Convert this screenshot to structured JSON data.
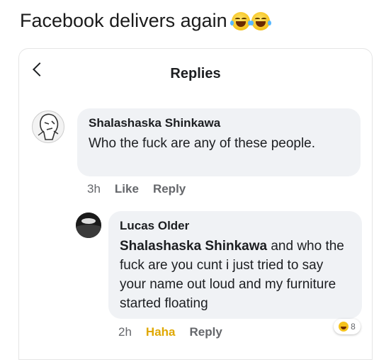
{
  "caption": {
    "text": "Facebook delivers again"
  },
  "header": {
    "title": "Replies"
  },
  "comments": [
    {
      "author": "Shalashaska Shinkawa",
      "text": "Who the fuck are any of these people.",
      "time": "3h",
      "like_label": "Like",
      "reply_label": "Reply"
    },
    {
      "author": "Lucas Older",
      "mention": "Shalashaska Shinkawa",
      "text": " and who the fuck are you cunt i just tried to say your name out loud and my furniture started floating",
      "time": "2h",
      "reaction_label": "Haha",
      "reply_label": "Reply",
      "reaction_count": "8"
    }
  ],
  "colors": {
    "bubble": "#f0f2f5",
    "meta": "#65676b",
    "haha": "#e0a800"
  },
  "icons": [
    "laugh-emoji-icon",
    "back-chevron-icon",
    "haha-reaction-icon"
  ]
}
